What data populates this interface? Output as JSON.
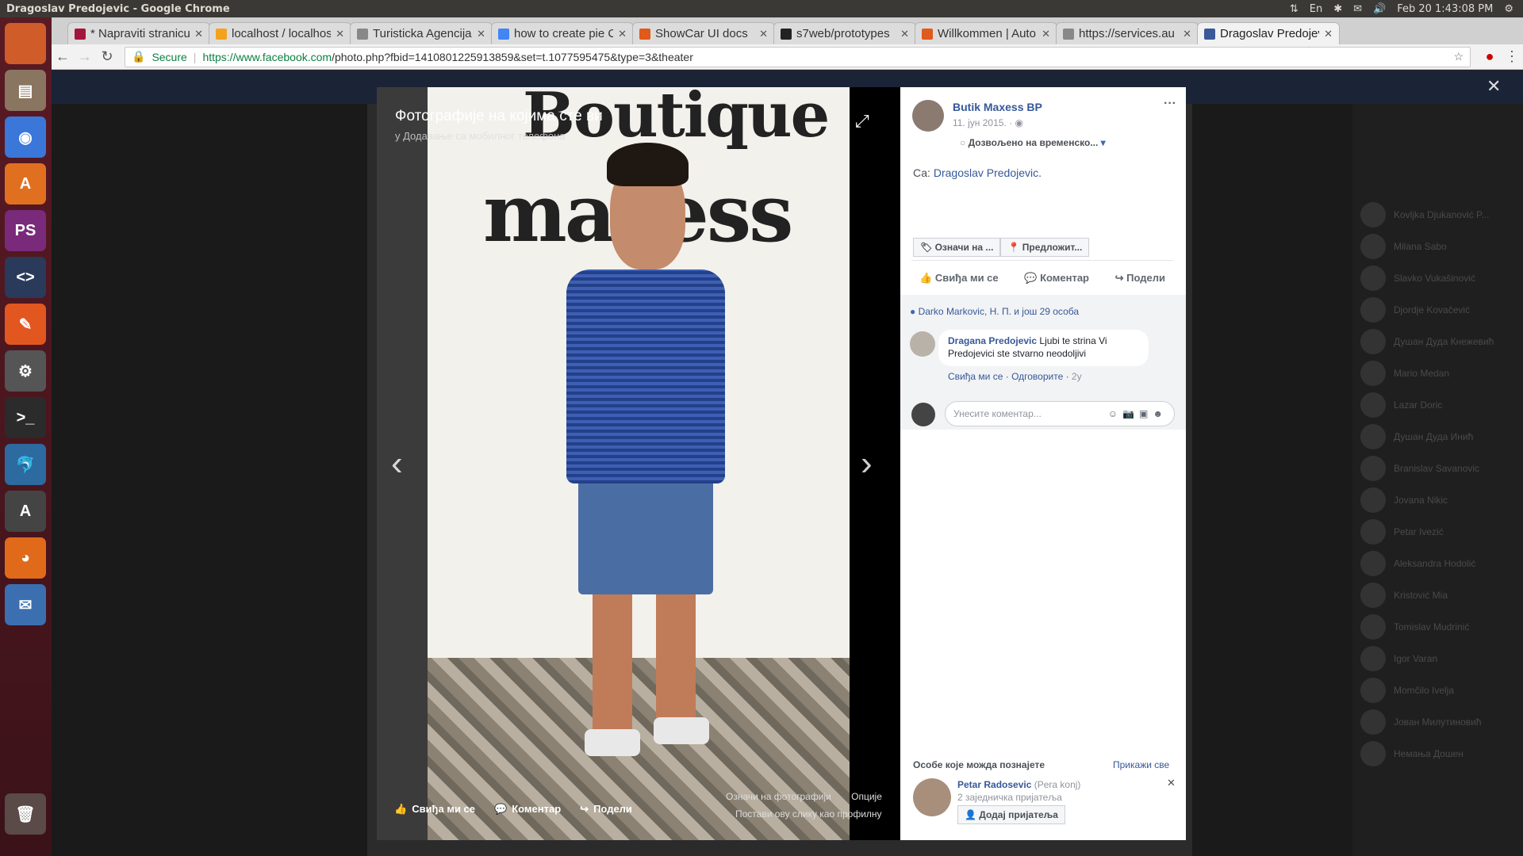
{
  "os": {
    "window_title": "Dragoslav Predojevic - Google Chrome",
    "clock": "Feb 20  1:43:08 PM",
    "keyboard": "En"
  },
  "launcher": [
    {
      "name": "ubuntu-home-icon",
      "label": "",
      "color": "#d05c2a"
    },
    {
      "name": "files-icon",
      "label": "▤",
      "color": "#8a7560"
    },
    {
      "name": "chrome-icon",
      "label": "◉",
      "color": "#3b77d9"
    },
    {
      "name": "software-center-icon",
      "label": "A",
      "color": "#e0701f"
    },
    {
      "name": "phpstorm-icon",
      "label": "PS",
      "color": "#7a2a7a"
    },
    {
      "name": "code-editor-icon",
      "label": "<>",
      "color": "#2a3a5a"
    },
    {
      "name": "web-tool-icon",
      "label": "✎",
      "color": "#e2571f"
    },
    {
      "name": "settings-icon",
      "label": "⚙",
      "color": "#555555"
    },
    {
      "name": "terminal-icon",
      "label": ">_",
      "color": "#2b2b2b"
    },
    {
      "name": "workbench-icon",
      "label": "🐬",
      "color": "#2d6aa0"
    },
    {
      "name": "updater-icon",
      "label": "A",
      "color": "#444444"
    },
    {
      "name": "firefox-icon",
      "label": "◕",
      "color": "#e06a19"
    },
    {
      "name": "thunderbird-icon",
      "label": "✉",
      "color": "#3b6fb0"
    },
    {
      "name": "trash-icon",
      "label": "🗑",
      "color": "#5a4a48"
    }
  ],
  "tabs": [
    {
      "title": "* Napraviti stranicu",
      "color": "#a3153a"
    },
    {
      "title": "localhost / localhost",
      "color": "#f3a21b"
    },
    {
      "title": "Turisticka Agencija",
      "color": "#888888"
    },
    {
      "title": "how to create pie C",
      "color": "#4285f4"
    },
    {
      "title": "ShowCar UI docs",
      "color": "#e05a1b"
    },
    {
      "title": "s7web/prototypes",
      "color": "#222222"
    },
    {
      "title": "Willkommen | Auto",
      "color": "#e05a1b"
    },
    {
      "title": "https://services.au",
      "color": "#888888"
    },
    {
      "title": "Dragoslav Predojev",
      "color": "#3b5998"
    }
  ],
  "address": {
    "secure_label": "Secure",
    "url_host": "https://www.facebook.com",
    "url_path": "/photo.php?fbid=1410801225913859&set=t.1077595475&type=3&theater"
  },
  "photo": {
    "album_title": "Фотографије на којима сте ви",
    "album_subtitle": "у Додавање са мобилног телефона",
    "brand_line1": "Boutique",
    "brand_line2": "maxess",
    "like": "Свиђа ми се",
    "comment": "Коментар",
    "share": "Подели",
    "tag_photo": "Означи на фотографији",
    "options": "Опције",
    "make_profile": "Постави ову слику као профилну"
  },
  "post": {
    "page_name": "Butik Maxess BP",
    "date": "11. јун 2015.",
    "privacy": "Дозвољено на временско...",
    "with_prefix": "Са:",
    "with_name": "Dragoslav Predojevic",
    "tag_btn": "Означи на ...",
    "location_btn": "Предложит...",
    "like": "Свиђа ми се",
    "comment": "Коментар",
    "share": "Подели",
    "likers": "Darko Markovic, Н. П. и још 29 особа",
    "comment_author": "Dragana Predojevic",
    "comment_text": "Ljubi te strina Vi Predojevici ste stvarno neodoljivi",
    "comment_like": "Свиђа ми се",
    "comment_reply": "Одговорите",
    "comment_age": "2y",
    "input_placeholder": "Унесите коментар..."
  },
  "pymk": {
    "title": "Особе које можда познајете",
    "see_all": "Прикажи све",
    "name": "Petar Radosevic",
    "alias": "(Pera konj)",
    "mutual": "2 заједничка пријатеља",
    "add": "Додај пријатеља"
  },
  "contacts": [
    "Kovljka Djukanović P...",
    "Milana Sabo",
    "Slavko Vukašinović",
    "Djordje Kovačević",
    "Душан Дуда Кнежевић",
    "Mario Medan",
    "Lazar Doric",
    "Душан Дуда Инић",
    "Branislav Savanovic",
    "Jovana Nikic",
    "Petar Ivezić",
    "Aleksandra Hodolić",
    "Kristović Mia",
    "Tomislav Mudrinić",
    "Igor Varan",
    "Momčilo Ivelja",
    "Јован Милутиновић",
    "Немања Дошен"
  ]
}
